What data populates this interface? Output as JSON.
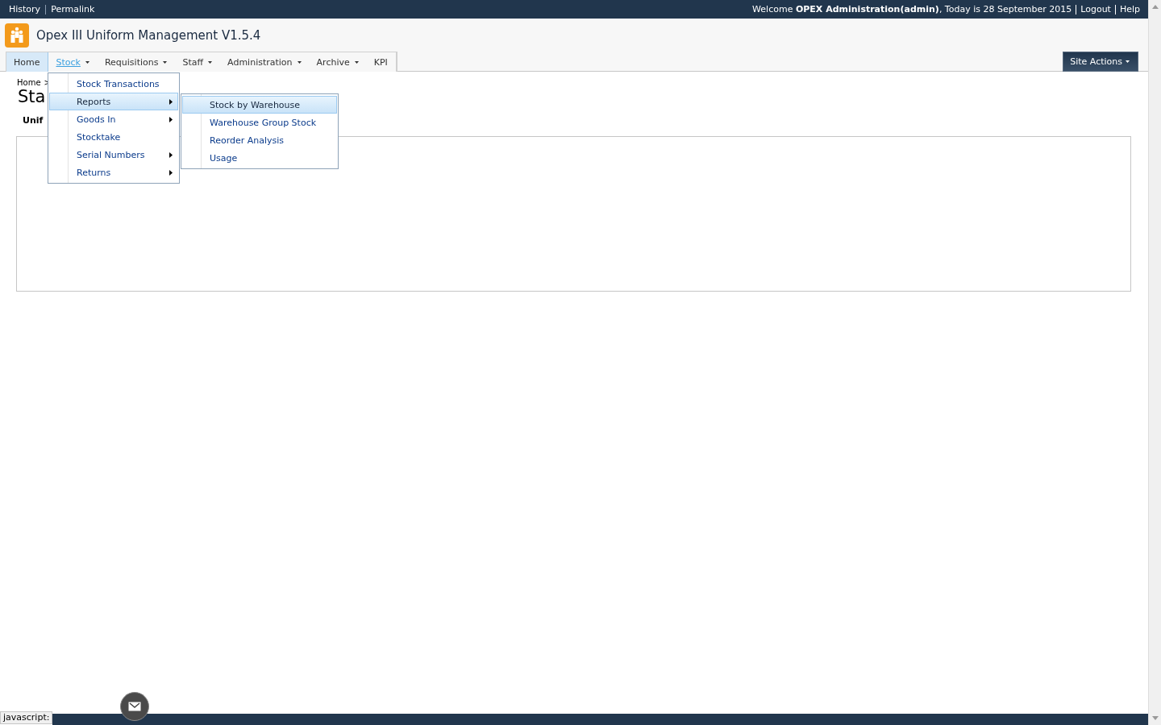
{
  "top_bar": {
    "left_links": [
      "History",
      "Permalink"
    ],
    "welcome": "Welcome **OPEX Administration(admin)**, Today is 28 September 2015",
    "right_links": [
      "Logout",
      "Help"
    ]
  },
  "app": {
    "title": "Opex III Uniform Management V1.5.4"
  },
  "nav": [
    {
      "label": "Home",
      "selected": true,
      "open": false,
      "has_menu": false
    },
    {
      "label": "Stock",
      "selected": false,
      "open": true,
      "has_menu": true
    },
    {
      "label": "Requisitions",
      "selected": false,
      "open": false,
      "has_menu": true
    },
    {
      "label": "Staff",
      "selected": false,
      "open": false,
      "has_menu": true
    },
    {
      "label": "Administration",
      "selected": false,
      "open": false,
      "has_menu": true
    },
    {
      "label": "Archive",
      "selected": false,
      "open": false,
      "has_menu": true
    },
    {
      "label": "KPI",
      "selected": false,
      "open": false,
      "has_menu": false
    }
  ],
  "site_actions": "Site Actions",
  "breadcrumb": [
    "Home",
    ">"
  ],
  "page_title": "Sta",
  "section_label": "Unif",
  "stock_menu": [
    {
      "label": "Stock Transactions",
      "selected": false,
      "has_submenu": false
    },
    {
      "label": "Reports",
      "selected": true,
      "has_submenu": true
    },
    {
      "label": "Goods In",
      "selected": false,
      "has_submenu": true
    },
    {
      "label": "Stocktake",
      "selected": false,
      "has_submenu": false
    },
    {
      "label": "Serial Numbers",
      "selected": false,
      "has_submenu": true
    },
    {
      "label": "Returns",
      "selected": false,
      "has_submenu": true
    }
  ],
  "reports_menu": [
    {
      "label": "Stock by Warehouse",
      "selected": true
    },
    {
      "label": "Warehouse Group Stock",
      "selected": false
    },
    {
      "label": "Reorder Analysis",
      "selected": false
    },
    {
      "label": "Usage",
      "selected": false
    }
  ],
  "status_text": "javascript:"
}
